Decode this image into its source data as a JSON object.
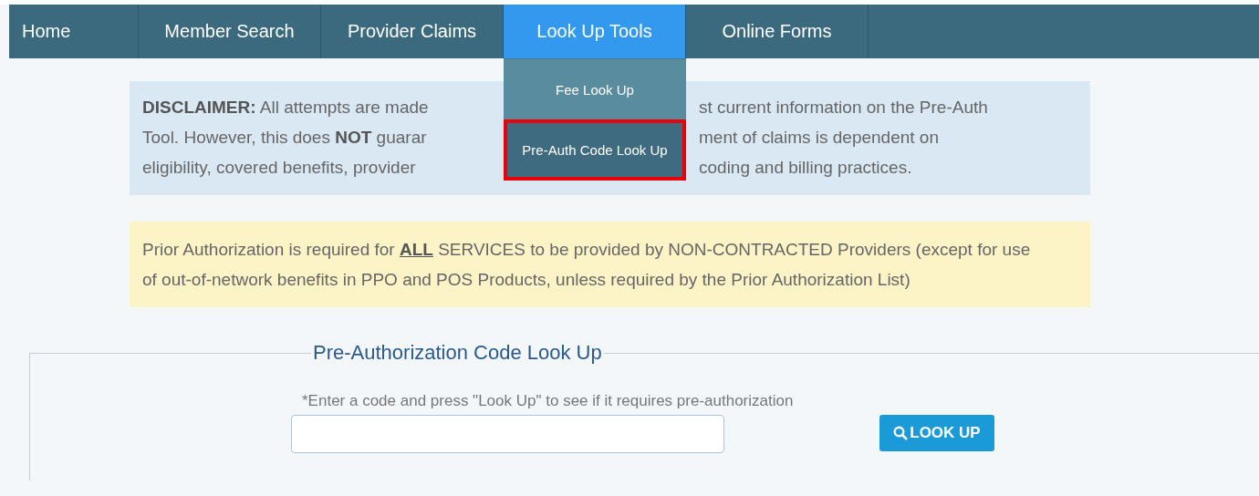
{
  "nav": {
    "items": [
      {
        "label": "Home",
        "selected": false
      },
      {
        "label": "Member Search",
        "selected": false
      },
      {
        "label": "Provider Claims",
        "selected": false
      },
      {
        "label": "Look Up Tools",
        "selected": true,
        "menu": [
          {
            "label": "Fee Look Up",
            "highlighted": false
          },
          {
            "label": "Pre-Auth Code Look Up",
            "highlighted": true
          }
        ]
      },
      {
        "label": "Online Forms",
        "selected": false
      }
    ]
  },
  "disclaimer": {
    "lines": [
      {
        "left": "**DISCLAIMER:** All attempts are made",
        "right": "st current information on the Pre-Auth"
      },
      {
        "left": "Tool. However, this does **NOT** guarar",
        "right": "ment of claims is dependent on"
      },
      {
        "left": "eligibility, covered benefits, provider",
        "right": "coding and billing practices."
      }
    ]
  },
  "notice": {
    "text": "Prior Authorization is required for **ALL** SERVICES to be provided by NON-CONTRACTED Providers (except for use of out-of-network benefits in PPO and POS Products, unless required by the Prior Authorization List)"
  },
  "lookup": {
    "legend": "Pre-Authorization Code Look Up",
    "hint": "*Enter a code and press \"Look Up\" to see if it requires pre-authorization",
    "button": "LOOK UP"
  }
}
